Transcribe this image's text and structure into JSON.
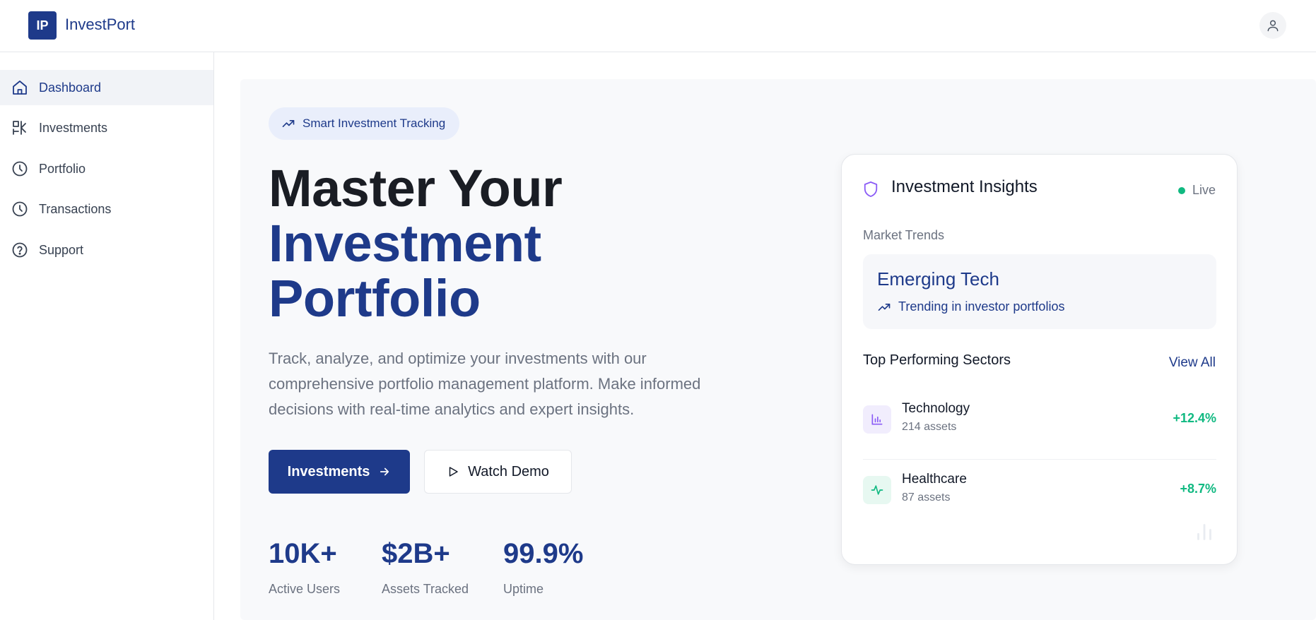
{
  "app": {
    "logo_initials": "IP",
    "name": "InvestPort"
  },
  "sidebar": {
    "items": [
      {
        "label": "Dashboard",
        "icon": "home-icon",
        "active": true
      },
      {
        "label": "Investments",
        "icon": "investments-icon",
        "active": false
      },
      {
        "label": "Portfolio",
        "icon": "clock-icon",
        "active": false
      },
      {
        "label": "Transactions",
        "icon": "clock-icon",
        "active": false
      },
      {
        "label": "Support",
        "icon": "help-circle-icon",
        "active": false
      }
    ]
  },
  "hero": {
    "badge": "Smart Investment Tracking",
    "title_line1": "Master Your",
    "title_line2": "Investment",
    "title_line3": "Portfolio",
    "description": "Track, analyze, and optimize your investments with our comprehensive portfolio management platform. Make informed decisions with real-time analytics and expert insights.",
    "primary_button": "Investments",
    "secondary_button": "Watch Demo",
    "stats": [
      {
        "value": "10K+",
        "label": "Active Users"
      },
      {
        "value": "$2B+",
        "label": "Assets Tracked"
      },
      {
        "value": "99.9%",
        "label": "Uptime"
      }
    ]
  },
  "insights": {
    "title": "Investment Insights",
    "status": "Live",
    "market_trends_label": "Market Trends",
    "trend_title": "Emerging Tech",
    "trend_subtitle": "Trending in investor portfolios",
    "sectors_heading": "Top Performing Sectors",
    "view_all": "View All",
    "sectors": [
      {
        "name": "Technology",
        "assets": "214 assets",
        "change": "+12.4%",
        "icon": "bar-chart-icon"
      },
      {
        "name": "Healthcare",
        "assets": "87 assets",
        "change": "+8.7%",
        "icon": "activity-icon"
      }
    ]
  },
  "colors": {
    "brand": "#1e3a8a",
    "positive": "#10b981",
    "accent_purple": "#8b5cf6"
  }
}
